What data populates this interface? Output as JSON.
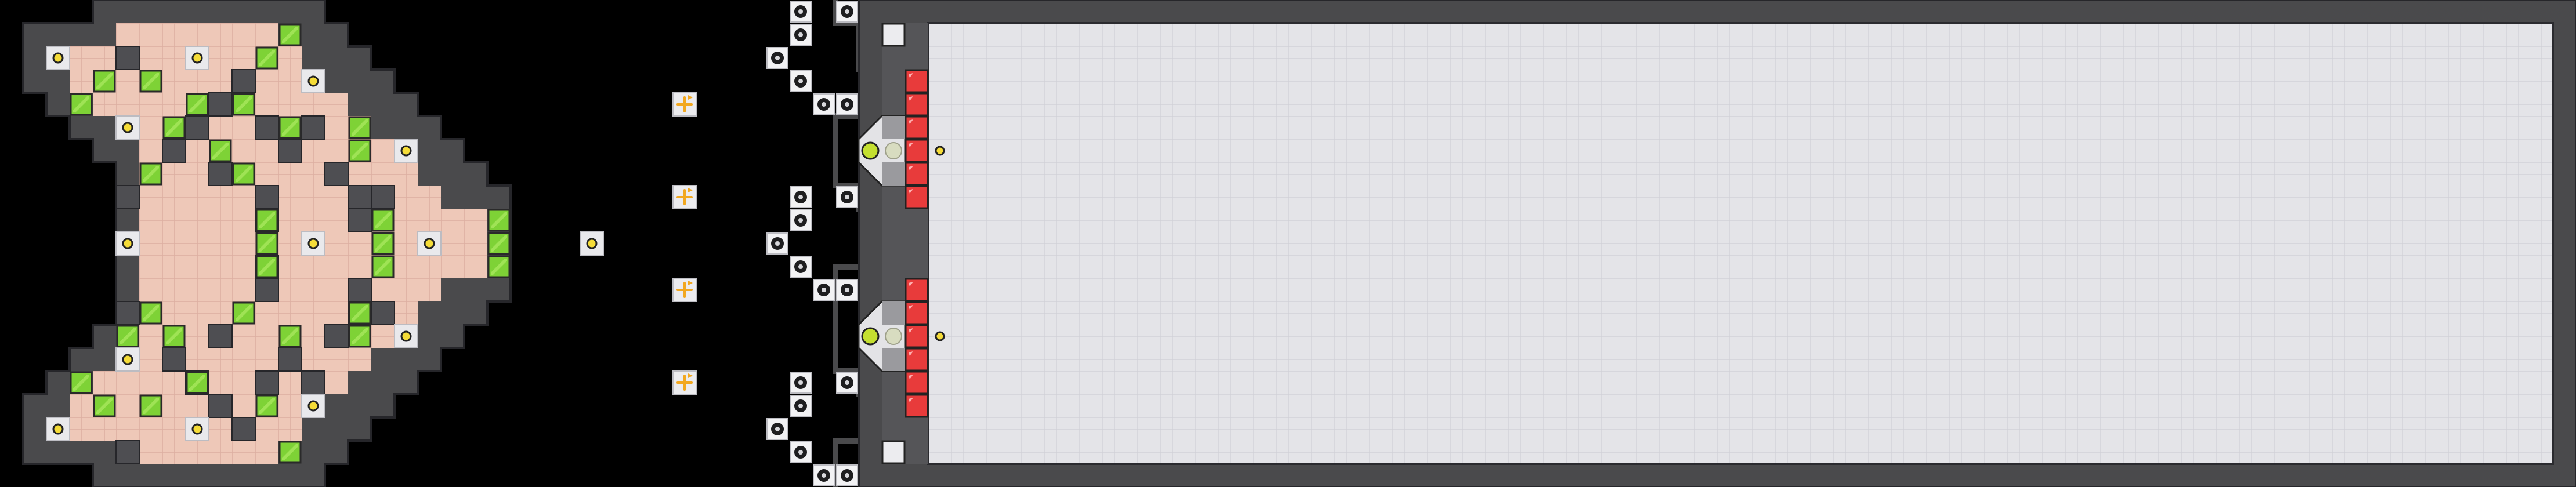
{
  "game": {
    "view": "level-map",
    "colors": {
      "background": "#000000",
      "wall": "#4a4a4c",
      "wall_edge": "#26262a",
      "floor_pink": "#eec8b8",
      "floor_grid": "#dcaea0",
      "dark_block": "#4e4e52",
      "green_block": "#7ed236",
      "red_block": "#e83b3b",
      "arena_floor": "#e4e4e8",
      "arena_grid": "#cfcfd6",
      "node_yellow": "#f5dc38",
      "rotate_orange": "#f2a820",
      "orb_lime": "#c4df30"
    },
    "icons": [
      "node-yellow-icon",
      "rotate-arrows-icon",
      "ring-pad-icon",
      "red-block-icon",
      "green-block-icon",
      "orb-icon"
    ]
  }
}
